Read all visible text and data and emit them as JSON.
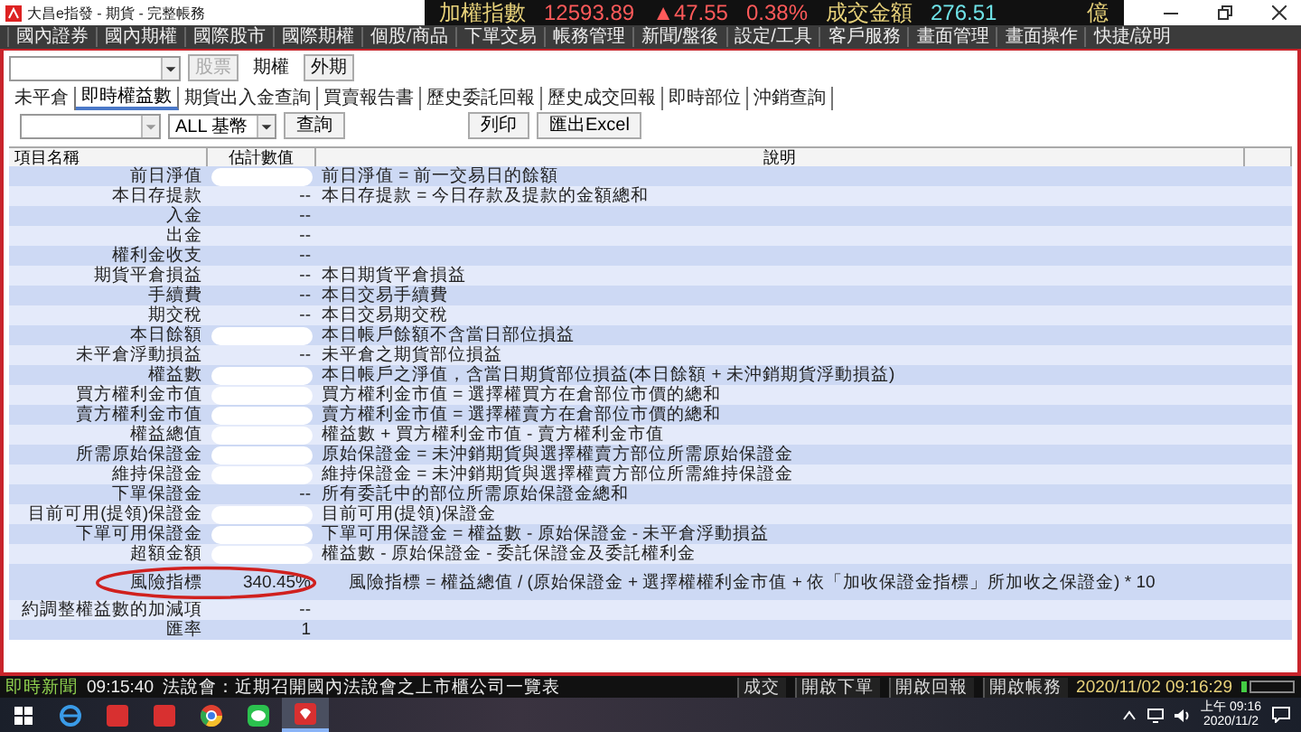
{
  "window": {
    "title": "大昌e指發 - 期貨 - 完整帳務"
  },
  "ticker": {
    "index_label": "加權指數",
    "index_value": "12593.89",
    "change": "▲47.55",
    "change_pct": "0.38%",
    "volume_label": "成交金額",
    "volume_value": "276.51",
    "unit": "億"
  },
  "menu": [
    "國內證券",
    "國內期權",
    "國際股市",
    "國際期權",
    "個股/商品",
    "下單交易",
    "帳務管理",
    "新聞/盤後",
    "設定/工具",
    "客戶服務",
    "畫面管理",
    "畫面操作",
    "快捷/說明"
  ],
  "markets": [
    {
      "label": "股票",
      "selected": false,
      "disabled": true
    },
    {
      "label": "期權",
      "selected": true,
      "disabled": false
    },
    {
      "label": "外期",
      "selected": false,
      "disabled": false
    }
  ],
  "tabs": [
    {
      "label": "未平倉",
      "selected": false
    },
    {
      "label": "即時權益數",
      "selected": true
    },
    {
      "label": "期貨出入金查詢",
      "selected": false
    },
    {
      "label": "買賣報告書",
      "selected": false
    },
    {
      "label": "歷史委託回報",
      "selected": false
    },
    {
      "label": "歷史成交回報",
      "selected": false
    },
    {
      "label": "即時部位",
      "selected": false
    },
    {
      "label": "沖銷查詢",
      "selected": false
    }
  ],
  "filters": {
    "currency": "ALL 基幣",
    "query_button": "查詢",
    "buttons": [
      "列印",
      "匯出Excel"
    ]
  },
  "table": {
    "columns": [
      "項目名稱",
      "估計數值",
      "說明"
    ],
    "rows": [
      {
        "name": "前日淨值",
        "redacted": true,
        "circled": false,
        "description": "前日淨值 = 前一交易日的餘額"
      },
      {
        "name": "本日存提款",
        "value": "--",
        "redacted": false,
        "circled": false,
        "description": "本日存提款 = 今日存款及提款的金額總和"
      },
      {
        "name": "入金",
        "value": "--",
        "redacted": false,
        "circled": false
      },
      {
        "name": "出金",
        "value": "--",
        "redacted": false,
        "circled": false
      },
      {
        "name": "權利金收支",
        "value": "--",
        "redacted": false,
        "circled": false
      },
      {
        "name": "期貨平倉損益",
        "value": "--",
        "redacted": false,
        "circled": false,
        "description": "本日期貨平倉損益"
      },
      {
        "name": "手續費",
        "value": "--",
        "redacted": false,
        "circled": false,
        "description": "本日交易手續費"
      },
      {
        "name": "期交稅",
        "value": "--",
        "redacted": false,
        "circled": false,
        "description": "本日交易期交稅"
      },
      {
        "name": "本日餘額",
        "redacted": true,
        "circled": false,
        "description": "本日帳戶餘額不含當日部位損益"
      },
      {
        "name": "未平倉浮動損益",
        "value": "--",
        "redacted": false,
        "circled": false,
        "description": "未平倉之期貨部位損益"
      },
      {
        "name": "權益數",
        "redacted": true,
        "circled": false,
        "description": "本日帳戶之淨值，含當日期貨部位損益(本日餘額 + 未沖銷期貨浮動損益)"
      },
      {
        "name": "買方權利金市值",
        "redacted": true,
        "circled": false,
        "description": "買方權利金市值 = 選擇權買方在倉部位市價的總和"
      },
      {
        "name": "賣方權利金市值",
        "redacted": true,
        "circled": false,
        "description": "賣方權利金市值 = 選擇權賣方在倉部位市價的總和"
      },
      {
        "name": "權益總值",
        "redacted": true,
        "circled": false,
        "description": "權益數 + 買方權利金市值 - 賣方權利金市值"
      },
      {
        "name": "所需原始保證金",
        "redacted": true,
        "circled": false,
        "description": "原始保證金 = 未沖銷期貨與選擇權賣方部位所需原始保證金"
      },
      {
        "name": "維持保證金",
        "redacted": true,
        "circled": false,
        "description": "維持保證金 = 未沖銷期貨與選擇權賣方部位所需維持保證金"
      },
      {
        "name": "下單保證金",
        "value": "--",
        "redacted": false,
        "circled": false,
        "description": "所有委託中的部位所需原始保證金總和"
      },
      {
        "name": "目前可用(提領)保證金",
        "redacted": true,
        "circled": false,
        "description": "目前可用(提領)保證金"
      },
      {
        "name": "下單可用保證金",
        "redacted": true,
        "circled": false,
        "description": "下單可用保證金 = 權益數 - 原始保證金 - 未平倉浮動損益"
      },
      {
        "name": "超額金額",
        "redacted": true,
        "circled": false,
        "description": "權益數 - 原始保證金 - 委託保證金及委託權利金"
      },
      {
        "name": "風險指標",
        "value": "340.45%",
        "redacted": false,
        "circled": true,
        "description": "風險指標 = 權益總值 / (原始保證金 + 選擇權權利金市值 + 依「加收保證金指標」所加收之保證金) * 10"
      },
      {
        "name": "約調整權益數的加減項",
        "value": "--",
        "redacted": false,
        "circled": false
      },
      {
        "name": "匯率",
        "value": "1",
        "redacted": false,
        "circled": false
      }
    ]
  },
  "status_bar": {
    "news_label": "即時新聞",
    "news_time": "09:15:40",
    "news_text": "法說會：近期召開國內法說會之上市櫃公司一覽表",
    "buttons": [
      "成交",
      "開啟下單",
      "開啟回報",
      "開啟帳務"
    ],
    "datetime": "2020/11/02 09:16:29"
  },
  "taskbar": {
    "time": "上午 09:16",
    "date": "2020/11/2"
  }
}
